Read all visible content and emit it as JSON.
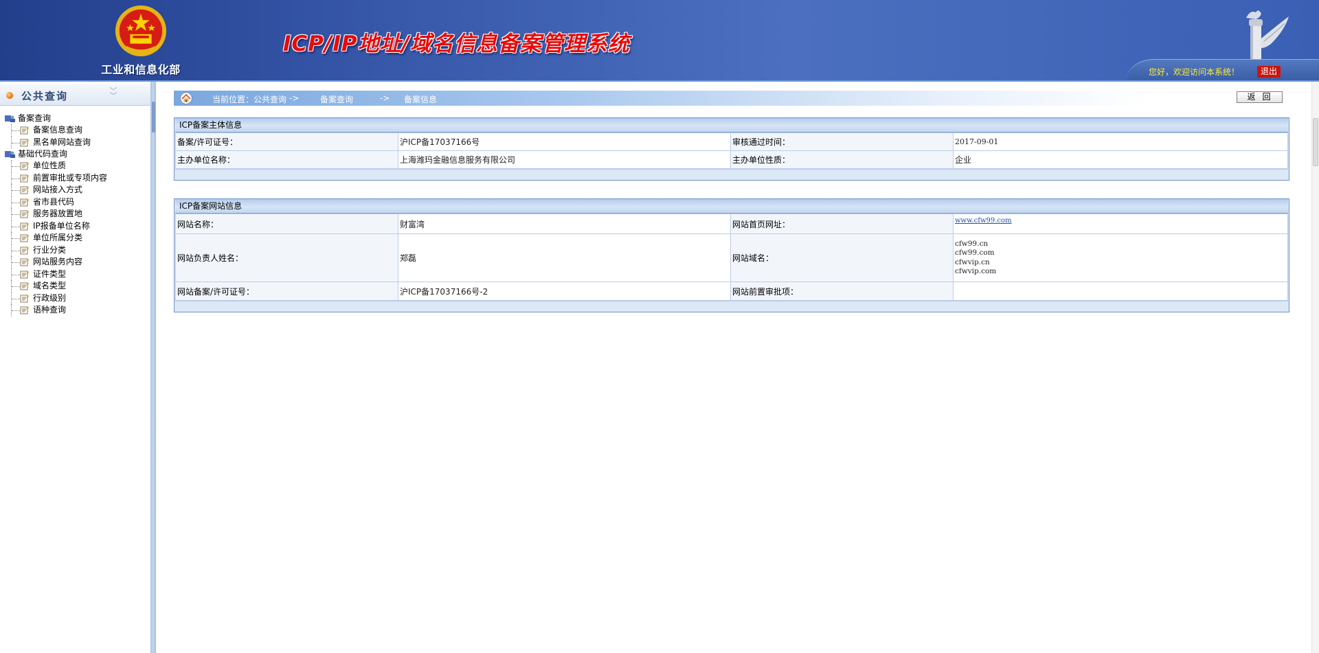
{
  "header": {
    "ministry_name": "工业和信息化部",
    "system_title": "ICP/IP地址/域名信息备案管理系统",
    "welcome_text": "您好，欢迎访问本系统！",
    "logout_label": "退出",
    "emblem_icon": "national-emblem-icon",
    "pillar_icon": "huabiao-pillar-icon"
  },
  "sidebar": {
    "title": "公共查询",
    "groups": [
      {
        "label": "备案查询",
        "items": [
          "备案信息查询",
          "黑名单网站查询"
        ]
      },
      {
        "label": "基础代码查询",
        "items": [
          "单位性质",
          "前置审批或专项内容",
          "网站接入方式",
          "省市县代码",
          "服务器放置地",
          "IP报备单位名称",
          "单位所属分类",
          "行业分类",
          "网站服务内容",
          "证件类型",
          "域名类型",
          "行政级别",
          "语种查询"
        ]
      }
    ]
  },
  "breadcrumb": {
    "prefix": "当前位置：公共查询",
    "sep1": "->",
    "level2": "备案查询",
    "sep2": "->",
    "level3": "备案信息"
  },
  "back_button_label": "返回",
  "entity_panel": {
    "title": "ICP备案主体信息",
    "license_label": "备案/许可证号：",
    "license_value": "沪ICP备17037166号",
    "approve_time_label": "审核通过时间：",
    "approve_time_value": "2017-09-01",
    "org_name_label": "主办单位名称：",
    "org_name_value": "上海潍玛金融信息服务有限公司",
    "org_type_label": "主办单位性质：",
    "org_type_value": "企业"
  },
  "site_panel": {
    "title": "ICP备案网站信息",
    "site_name_label": "网站名称：",
    "site_name_value": "财富湾",
    "homepage_label": "网站首页网址：",
    "homepage_value": "www.cfw99.com",
    "owner_label": "网站负责人姓名：",
    "owner_value": "郑磊",
    "domain_label": "网站域名：",
    "domains": [
      "cfw99.cn",
      "cfw99.com",
      "cfwvip.cn",
      "cfwvip.com"
    ],
    "site_license_label": "网站备案/许可证号：",
    "site_license_value": "沪ICP备17037166号-2",
    "pre_approval_label": "网站前置审批项：",
    "pre_approval_value": ""
  },
  "colors": {
    "header_blue": "#3858aa",
    "title_red": "#e60c0c",
    "welcome_yellow": "#ffee32",
    "logout_red": "#c8160e"
  }
}
